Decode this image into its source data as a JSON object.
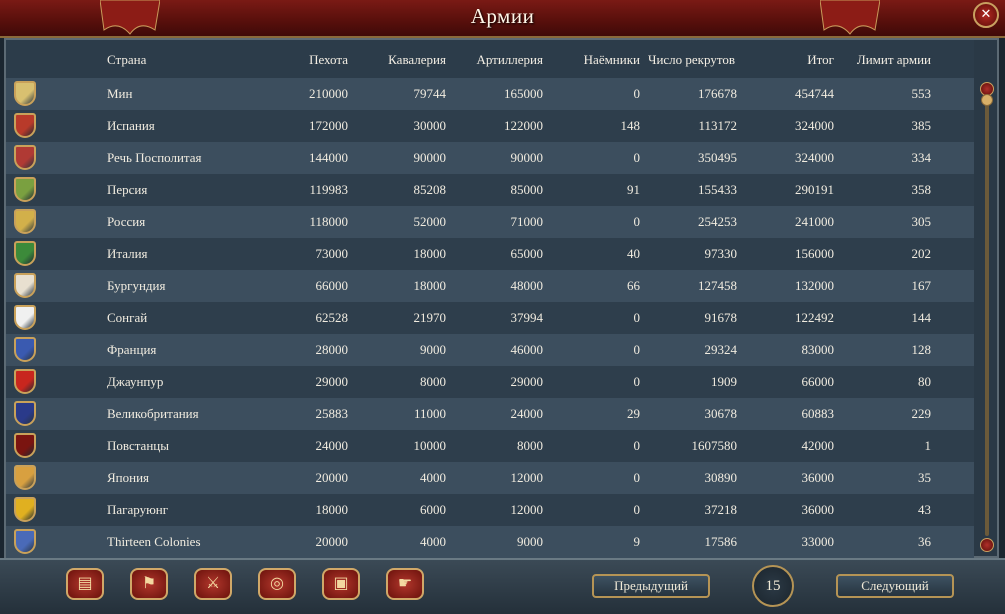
{
  "window": {
    "title": "Армии"
  },
  "columns": {
    "country": "Страна",
    "infantry": "Пехота",
    "cavalry": "Кавалерия",
    "artillery": "Артиллерия",
    "mercenaries": "Наёмники",
    "manpower": "Число рекрутов",
    "total": "Итог",
    "limit": "Лимит армии"
  },
  "rows": [
    {
      "country": "Мин",
      "infantry": "210000",
      "cavalry": "79744",
      "artillery": "165000",
      "mercenaries": "0",
      "manpower": "176678",
      "total": "454744",
      "limit": "553",
      "shield_color": "#d8c070",
      "shield_icon": "ming-shield-icon"
    },
    {
      "country": "Испания",
      "infantry": "172000",
      "cavalry": "30000",
      "artillery": "122000",
      "mercenaries": "148",
      "manpower": "113172",
      "total": "324000",
      "limit": "385",
      "shield_color": "#b83a2a",
      "shield_icon": "spain-shield-icon"
    },
    {
      "country": "Речь Посполитая",
      "infantry": "144000",
      "cavalry": "90000",
      "artillery": "90000",
      "mercenaries": "0",
      "manpower": "350495",
      "total": "324000",
      "limit": "334",
      "shield_color": "#b03a34",
      "shield_icon": "poland-shield-icon"
    },
    {
      "country": "Персия",
      "infantry": "119983",
      "cavalry": "85208",
      "artillery": "85000",
      "mercenaries": "91",
      "manpower": "155433",
      "total": "290191",
      "limit": "358",
      "shield_color": "#7aa040",
      "shield_icon": "persia-shield-icon"
    },
    {
      "country": "Россия",
      "infantry": "118000",
      "cavalry": "52000",
      "artillery": "71000",
      "mercenaries": "0",
      "manpower": "254253",
      "total": "241000",
      "limit": "305",
      "shield_color": "#d2b04a",
      "shield_icon": "russia-shield-icon"
    },
    {
      "country": "Италия",
      "infantry": "73000",
      "cavalry": "18000",
      "artillery": "65000",
      "mercenaries": "40",
      "manpower": "97330",
      "total": "156000",
      "limit": "202",
      "shield_color": "#3c8a3a",
      "shield_icon": "italy-shield-icon"
    },
    {
      "country": "Бургундия",
      "infantry": "66000",
      "cavalry": "18000",
      "artillery": "48000",
      "mercenaries": "66",
      "manpower": "127458",
      "total": "132000",
      "limit": "167",
      "shield_color": "#e8e0d0",
      "shield_icon": "burgundy-shield-icon"
    },
    {
      "country": "Сонгай",
      "infantry": "62528",
      "cavalry": "21970",
      "artillery": "37994",
      "mercenaries": "0",
      "manpower": "91678",
      "total": "122492",
      "limit": "144",
      "shield_color": "#f0f0f0",
      "shield_icon": "songhai-shield-icon"
    },
    {
      "country": "Франция",
      "infantry": "28000",
      "cavalry": "9000",
      "artillery": "46000",
      "mercenaries": "0",
      "manpower": "29324",
      "total": "83000",
      "limit": "128",
      "shield_color": "#3a5ab0",
      "shield_icon": "france-shield-icon"
    },
    {
      "country": "Джаунпур",
      "infantry": "29000",
      "cavalry": "8000",
      "artillery": "29000",
      "mercenaries": "0",
      "manpower": "1909",
      "total": "66000",
      "limit": "80",
      "shield_color": "#c8261e",
      "shield_icon": "jaunpur-shield-icon"
    },
    {
      "country": "Великобритания",
      "infantry": "25883",
      "cavalry": "11000",
      "artillery": "24000",
      "mercenaries": "29",
      "manpower": "30678",
      "total": "60883",
      "limit": "229",
      "shield_color": "#2a3a8a",
      "shield_icon": "great-britain-shield-icon"
    },
    {
      "country": "Повстанцы",
      "infantry": "24000",
      "cavalry": "10000",
      "artillery": "8000",
      "mercenaries": "0",
      "manpower": "1607580",
      "total": "42000",
      "limit": "1",
      "shield_color": "#7a1410",
      "shield_icon": "rebels-shield-icon"
    },
    {
      "country": "Япония",
      "infantry": "20000",
      "cavalry": "4000",
      "artillery": "12000",
      "mercenaries": "0",
      "manpower": "30890",
      "total": "36000",
      "limit": "35",
      "shield_color": "#d8a040",
      "shield_icon": "japan-shield-icon"
    },
    {
      "country": "Пагаруюнг",
      "infantry": "18000",
      "cavalry": "6000",
      "artillery": "12000",
      "mercenaries": "0",
      "manpower": "37218",
      "total": "36000",
      "limit": "43",
      "shield_color": "#e0b020",
      "shield_icon": "pagaruyung-shield-icon"
    },
    {
      "country": "Thirteen Colonies",
      "infantry": "20000",
      "cavalry": "4000",
      "artillery": "9000",
      "mercenaries": "9",
      "manpower": "17586",
      "total": "33000",
      "limit": "36",
      "shield_color": "#4a6ab8",
      "shield_icon": "thirteen-colonies-shield-icon"
    }
  ],
  "pagination": {
    "prev_label": "Предыдущий",
    "next_label": "Следующий",
    "page": "15"
  },
  "toolbar": {
    "icons": [
      "ledger-icon",
      "flags-icon",
      "crossed-swords-icon",
      "coins-icon",
      "trade-goods-icon",
      "handshake-icon"
    ],
    "glyphs": [
      "▤",
      "⚑",
      "⚔",
      "◎",
      "▣",
      "☛"
    ]
  },
  "accent_colors": {
    "banner": "#7a1a15",
    "gold_trim": "#c9a15a",
    "row_light": "#3c4e5e",
    "row_dark": "#2e3e4c"
  }
}
